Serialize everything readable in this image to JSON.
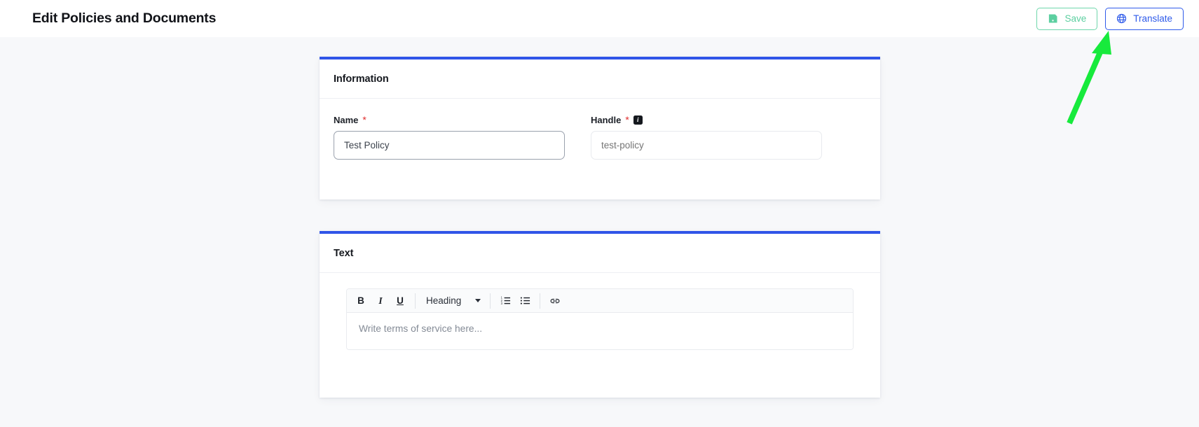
{
  "header": {
    "title": "Edit Policies and Documents",
    "actions": [
      {
        "id": "save",
        "label": "Save",
        "icon": "save-icon",
        "color": "#5ccfa0"
      },
      {
        "id": "translate",
        "label": "Translate",
        "icon": "globe-icon",
        "color": "#2f5bea"
      }
    ]
  },
  "cards": {
    "information": {
      "title": "Information",
      "accent_color": "#3055e8",
      "fields": {
        "name": {
          "label": "Name",
          "required_marker": "*",
          "value": "Test Policy",
          "placeholder": "Test Policy"
        },
        "handle": {
          "label": "Handle",
          "required_marker": "*",
          "info_icon": "info-icon",
          "info_glyph": "i",
          "value": "",
          "placeholder": "test-policy"
        }
      }
    },
    "text": {
      "title": "Text",
      "accent_color": "#3055e8",
      "editor": {
        "toolbar": {
          "bold_label": "B",
          "italic_label": "I",
          "underline_label": "U",
          "block_format": "Heading",
          "ordered_list_icon": "ordered-list-icon",
          "bullet_list_icon": "bullet-list-icon",
          "link_icon": "link-icon"
        },
        "content": "",
        "placeholder": "Write terms of service here..."
      }
    }
  },
  "annotation": {
    "type": "arrow",
    "color": "#17ea3c",
    "points_to": "translate-button"
  }
}
